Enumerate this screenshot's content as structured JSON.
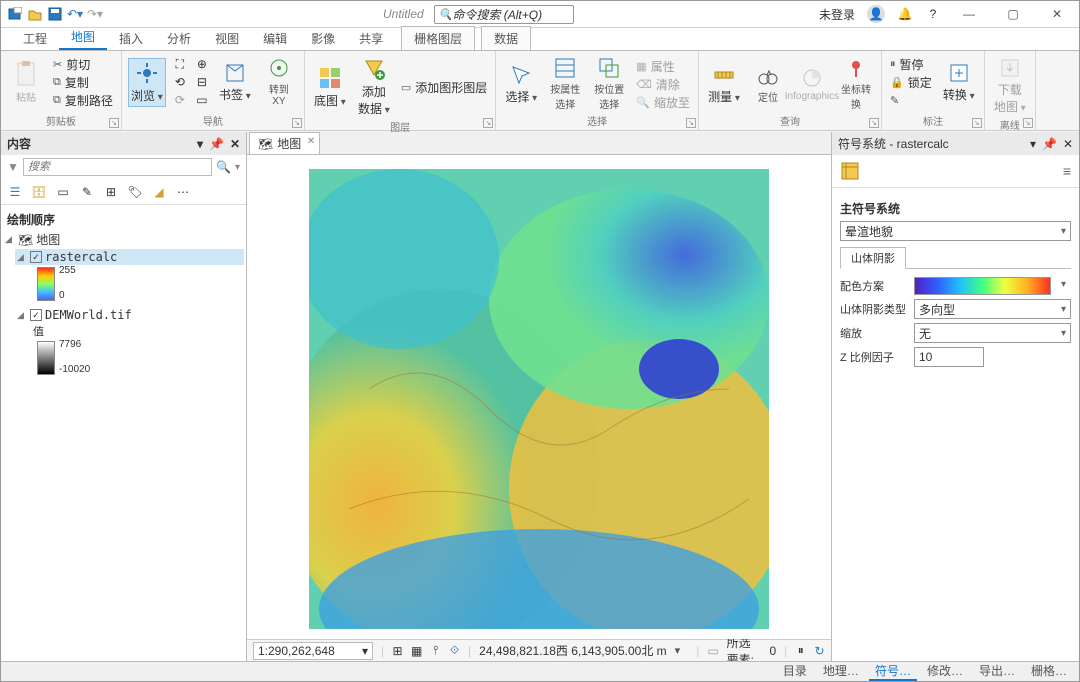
{
  "titlebar": {
    "title": "Untitled",
    "search_placeholder": "命令搜索 (Alt+Q)",
    "login": "未登录"
  },
  "ribbon_tabs": {
    "project": "工程",
    "map": "地图",
    "insert": "插入",
    "analysis": "分析",
    "view": "视图",
    "edit": "编辑",
    "imagery": "影像",
    "share": "共享",
    "ctx1": "栅格图层",
    "ctx2": "数据"
  },
  "ribbon": {
    "clipboard": {
      "cut": "剪切",
      "copy": "复制",
      "copypath": "复制路径",
      "paste": "粘贴",
      "group": "剪贴板"
    },
    "nav": {
      "explore": "浏览",
      "bookmarks": "书签",
      "goto": "转到 XY",
      "group": "导航"
    },
    "layer": {
      "basemap": "底图",
      "adddata": "添加数据",
      "addgraphics": "添加图形图层",
      "group": "图层"
    },
    "selection": {
      "select": "选择",
      "byattr": "按属性选择",
      "byloc": "按位置选择",
      "attrs": "属性",
      "clear": "清除",
      "zoomto": "缩放至",
      "group": "选择"
    },
    "inquiry": {
      "measure": "测量",
      "locate": "定位",
      "infog": "Infographics",
      "coord": "坐标转换",
      "group": "查询"
    },
    "labeling": {
      "pause": "暂停",
      "lock": "锁定",
      "convert": "转换",
      "download": "下载地图",
      "group1": "标注",
      "group2": "离线"
    }
  },
  "contents": {
    "title": "内容",
    "search": "搜索",
    "drawing_order": "绘制顺序",
    "map": "地图",
    "layer1": {
      "name": "rastercalc",
      "max": "255",
      "min": "0"
    },
    "layer2": {
      "name": "DEMWorld.tif",
      "value": "值",
      "max": "7796",
      "min": "-10020"
    }
  },
  "mapview": {
    "tab": "地图",
    "scale": "1:290,262,648",
    "coords": "24,498,821.18西 6,143,905.00北 m",
    "selected_label": "所选要素:",
    "selected": "0"
  },
  "symbology": {
    "title": "符号系统 - rastercalc",
    "main_header": "主符号系统",
    "renderer": "晕渲地貌",
    "subtab": "山体阴影",
    "colorscheme_label": "配色方案",
    "hillshade_type_label": "山体阴影类型",
    "hillshade_type": "多向型",
    "scaling_label": "缩放",
    "scaling": "无",
    "zfactor_label": "Z 比例因子",
    "zfactor": "10"
  },
  "bottom_tabs": {
    "catalog": "目录",
    "geo": "地理…",
    "symbology": "符号…",
    "modify": "修改…",
    "export": "导出…",
    "raster": "栅格…"
  }
}
